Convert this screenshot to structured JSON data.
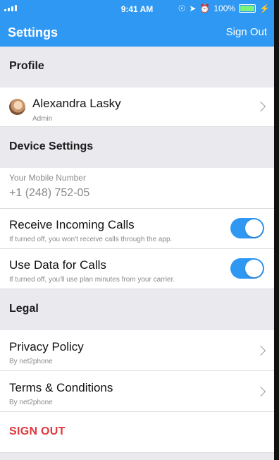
{
  "status_bar": {
    "time": "9:41 AM",
    "battery_percent": "100%"
  },
  "nav": {
    "title": "Settings",
    "sign_out": "Sign Out"
  },
  "sections": {
    "profile": "Profile",
    "device_settings": "Device Settings",
    "legal": "Legal"
  },
  "profile": {
    "name": "Alexandra Lasky",
    "role": "Admin"
  },
  "device": {
    "mobile_label": "Your Mobile Number",
    "mobile_value": "+1 (248) 752-05",
    "incoming_calls": {
      "title": "Receive Incoming Calls",
      "subtitle": "If turned off, you won't receive calls through the app.",
      "enabled": true
    },
    "data_calls": {
      "title": "Use Data for Calls",
      "subtitle": "If turned off, you'll use plan minutes from your carrier.",
      "enabled": true
    }
  },
  "legal": {
    "privacy": {
      "title": "Privacy Policy",
      "subtitle": "By net2phone"
    },
    "terms": {
      "title": "Terms & Conditions",
      "subtitle": "By net2phone"
    }
  },
  "footer": {
    "sign_out": "SIGN OUT"
  },
  "colors": {
    "accent": "#2f98f3",
    "danger": "#e0383d",
    "background": "#e9e9ee"
  }
}
